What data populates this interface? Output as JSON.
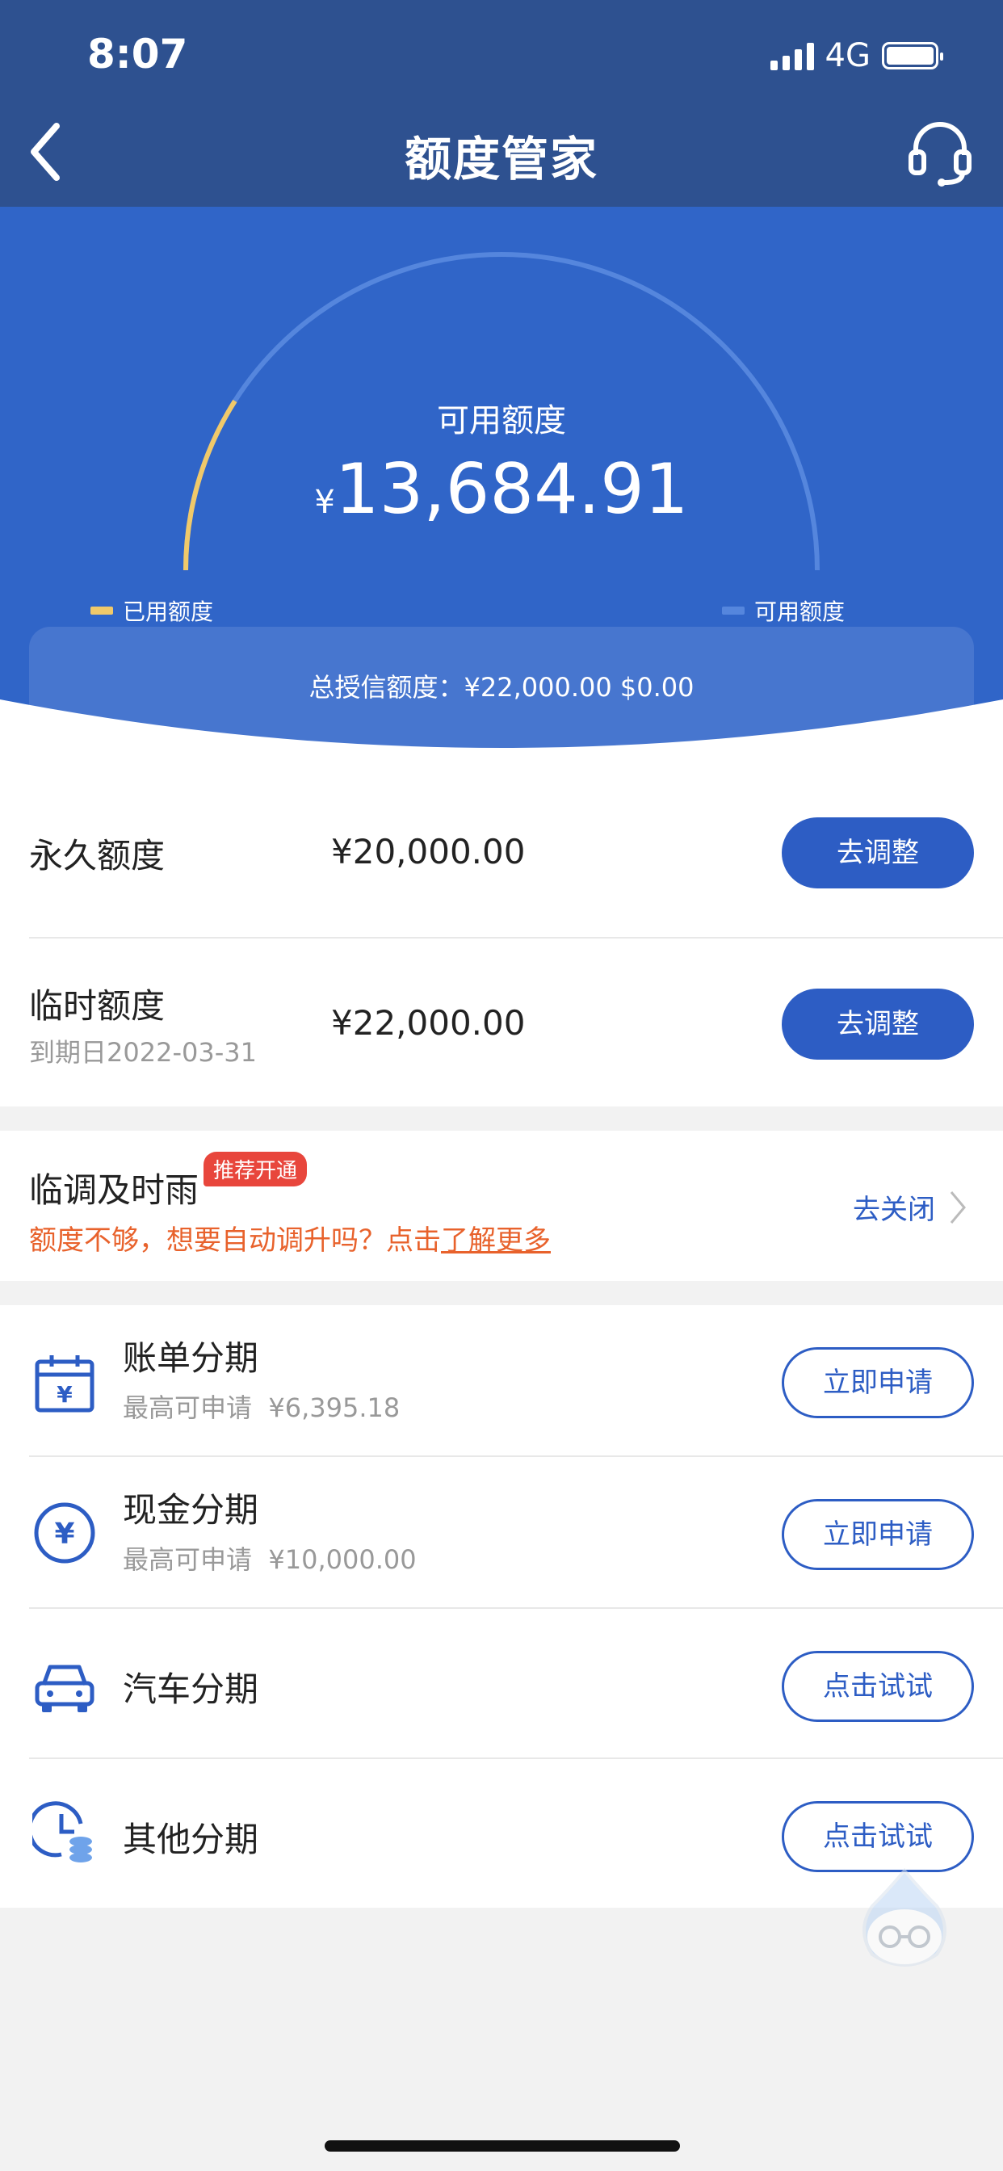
{
  "status_bar": {
    "time": "8:07",
    "network": "4G"
  },
  "header": {
    "title": "额度管家"
  },
  "hero": {
    "available_label": "可用额度",
    "currency_symbol": "¥",
    "available_amount": "13,684.91",
    "legend_used": "已用额度",
    "legend_available": "可用额度",
    "total_credit_text": "总授信额度：¥22,000.00  $0.00",
    "used_fraction": 0.18
  },
  "limits": [
    {
      "label": "永久额度",
      "amount": "¥20,000.00",
      "button": "去调整"
    },
    {
      "label": "临时额度",
      "sub": "到期日2022-03-31",
      "amount": "¥22,000.00",
      "button": "去调整"
    }
  ],
  "auto_raise": {
    "title": "临调及时雨",
    "badge": "推荐开通",
    "promo_text": "额度不够，想要自动调升吗？点击",
    "promo_link": "了解更多",
    "action": "去关闭"
  },
  "installments": [
    {
      "title": "账单分期",
      "sub_label": "最高可申请",
      "sub_amount": "¥6,395.18",
      "button": "立即申请",
      "icon": "calendar-yuan-icon"
    },
    {
      "title": "现金分期",
      "sub_label": "最高可申请",
      "sub_amount": "¥10,000.00",
      "button": "立即申请",
      "icon": "yuan-coin-icon"
    },
    {
      "title": "汽车分期",
      "button": "点击试试",
      "icon": "car-icon"
    },
    {
      "title": "其他分期",
      "button": "点击试试",
      "icon": "clock-coins-icon"
    }
  ],
  "colors": {
    "primary": "#2d5dc4",
    "header": "#2e5190",
    "hero": "#3065c8",
    "used": "#f0c96a",
    "promo": "#e8622c",
    "badge": "#e8463c"
  }
}
